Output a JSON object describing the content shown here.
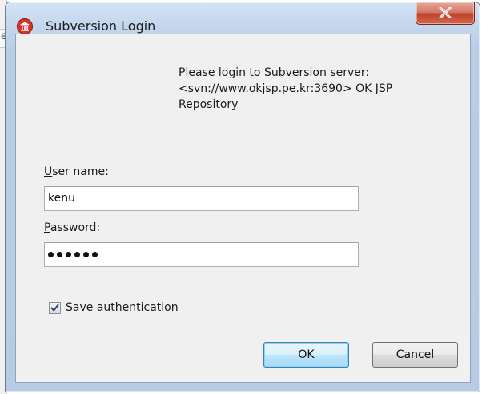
{
  "window": {
    "title": "Subversion Login",
    "app_icon": "subversion-icon",
    "close_icon": "close-icon"
  },
  "background": {
    "fragment": "e."
  },
  "message": "Please login to Subversion server:\n<svn://www.okjsp.pe.kr:3690> OK JSP\nRepository",
  "username": {
    "label_underlined": "U",
    "label_rest": "ser name:",
    "value": "kenu"
  },
  "password": {
    "label_underlined": "P",
    "label_rest": "assword:",
    "masked_length": 6
  },
  "save_auth": {
    "label": "Save authentication",
    "checked": true
  },
  "buttons": {
    "ok": "OK",
    "cancel": "Cancel"
  },
  "colors": {
    "close_button": "#c0432b",
    "ok_button_border": "#3c7fb1",
    "dialog_bg": "#f0f0f0"
  }
}
